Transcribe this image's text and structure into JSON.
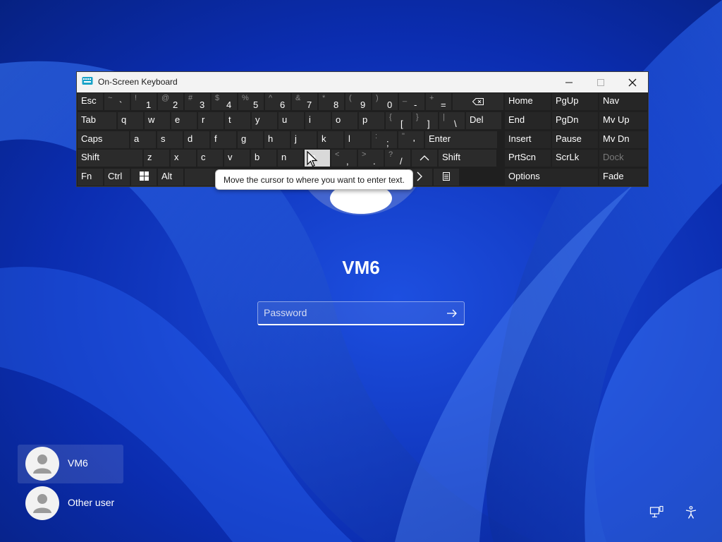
{
  "osk": {
    "title": "On-Screen Keyboard",
    "app_icon": "keyboard-icon",
    "window_controls": [
      "minimize-icon",
      "maximize-icon",
      "close-icon"
    ],
    "rows": [
      [
        {
          "label": "Esc"
        },
        {
          "shift": "~",
          "char": "`"
        },
        {
          "shift": "!",
          "char": "1"
        },
        {
          "shift": "@",
          "char": "2"
        },
        {
          "shift": "#",
          "char": "3"
        },
        {
          "shift": "$",
          "char": "4"
        },
        {
          "shift": "%",
          "char": "5"
        },
        {
          "shift": "^",
          "char": "6"
        },
        {
          "shift": "&",
          "char": "7"
        },
        {
          "shift": "*",
          "char": "8"
        },
        {
          "shift": "(",
          "char": "9"
        },
        {
          "shift": ")",
          "char": "0"
        },
        {
          "shift": "_",
          "char": "-"
        },
        {
          "shift": "+",
          "char": "="
        },
        {
          "icon": "backspace-icon"
        }
      ],
      [
        {
          "label": "Tab"
        },
        {
          "label": "q"
        },
        {
          "label": "w"
        },
        {
          "label": "e"
        },
        {
          "label": "r"
        },
        {
          "label": "t"
        },
        {
          "label": "y"
        },
        {
          "label": "u"
        },
        {
          "label": "i"
        },
        {
          "label": "o"
        },
        {
          "label": "p"
        },
        {
          "shift": "{",
          "char": "["
        },
        {
          "shift": "}",
          "char": "]"
        },
        {
          "shift": "|",
          "char": "\\"
        },
        {
          "label": "Del"
        }
      ],
      [
        {
          "label": "Caps"
        },
        {
          "label": "a"
        },
        {
          "label": "s"
        },
        {
          "label": "d"
        },
        {
          "label": "f"
        },
        {
          "label": "g"
        },
        {
          "label": "h"
        },
        {
          "label": "j"
        },
        {
          "label": "k"
        },
        {
          "label": "l"
        },
        {
          "shift": ":",
          "char": ";"
        },
        {
          "shift": "\"",
          "char": "'"
        },
        {
          "label": "Enter"
        }
      ],
      [
        {
          "label": "Shift"
        },
        {
          "label": "z"
        },
        {
          "label": "x"
        },
        {
          "label": "c"
        },
        {
          "label": "v"
        },
        {
          "label": "b"
        },
        {
          "label": "n"
        },
        {
          "label": "m"
        },
        {
          "shift": "<",
          "char": ","
        },
        {
          "shift": ">",
          "char": "."
        },
        {
          "shift": "?",
          "char": "/"
        },
        {
          "icon": "arrow-up-icon"
        },
        {
          "label": "Shift"
        }
      ],
      [
        {
          "label": "Fn"
        },
        {
          "label": "Ctrl"
        },
        {
          "icon": "windows-icon"
        },
        {
          "label": "Alt"
        },
        {
          "label": ""
        },
        {
          "icon": "arrow-down-icon"
        },
        {
          "icon": "arrow-right-icon"
        },
        {
          "icon": "context-menu-icon"
        }
      ]
    ],
    "nav_keys": [
      [
        "Home",
        "PgUp",
        "Nav"
      ],
      [
        "End",
        "PgDn",
        "Mv Up"
      ],
      [
        "Insert",
        "Pause",
        "Mv Dn"
      ],
      [
        "PrtScn",
        "ScrLk",
        "Dock"
      ],
      [
        "Options",
        "Fade"
      ]
    ],
    "hovered_key": "m",
    "tooltip": "Move the cursor to where you want to enter text."
  },
  "login": {
    "username": "VM6",
    "password_placeholder": "Password",
    "submit_icon": "arrow-right-icon"
  },
  "users": [
    {
      "name": "VM6",
      "selected": true
    },
    {
      "name": "Other user",
      "selected": false
    }
  ],
  "corner_icons": [
    "network-icon",
    "accessibility-icon"
  ],
  "colors": {
    "wallpaper": "#0a2aa8",
    "key_bg": "#2b2b2b",
    "keyboard_bg": "#1f1f1f",
    "key_hover": "#d9d9d9"
  }
}
